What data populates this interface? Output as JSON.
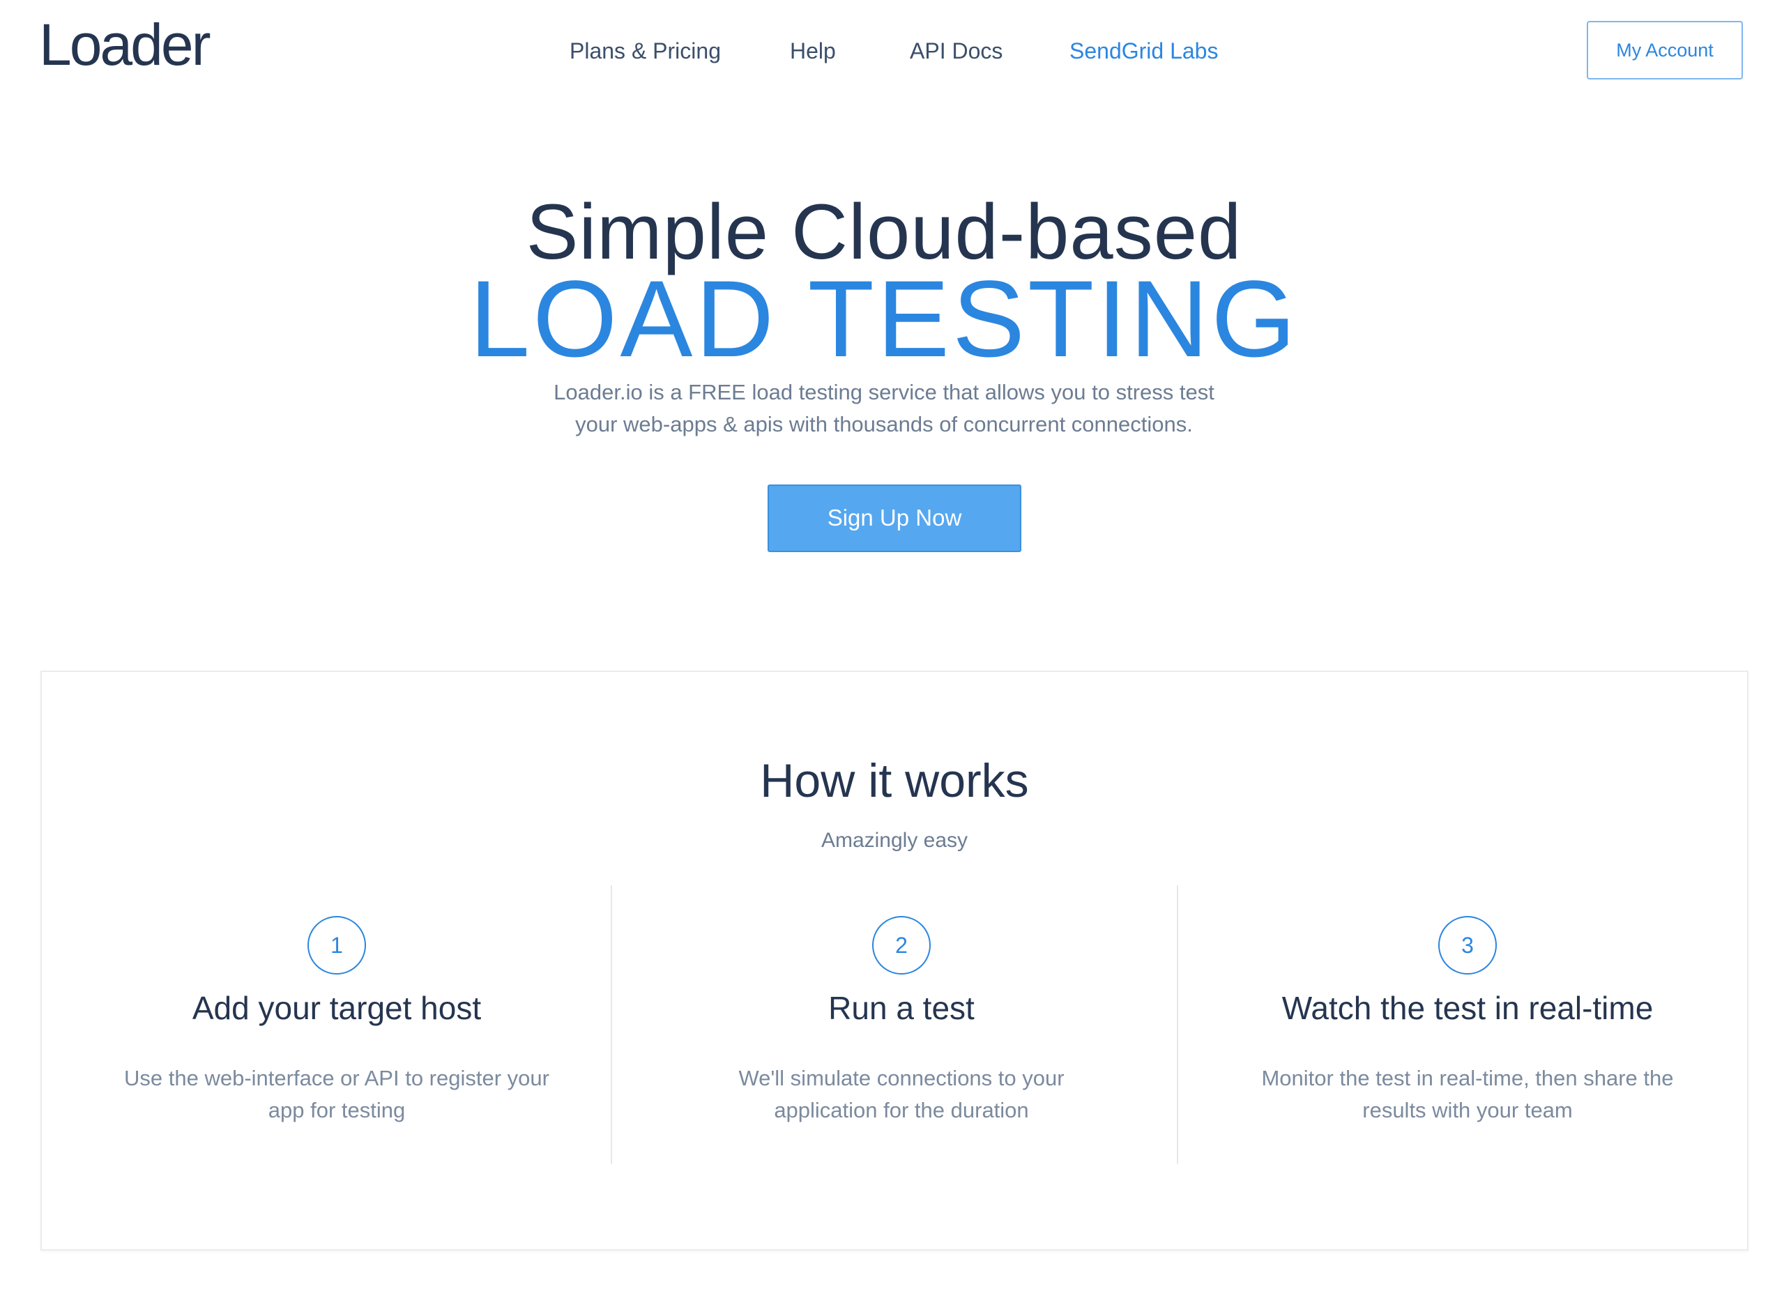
{
  "header": {
    "logo": "Loader",
    "nav": [
      {
        "label": "Plans & Pricing"
      },
      {
        "label": "Help"
      },
      {
        "label": "API Docs"
      },
      {
        "label": "SendGrid Labs"
      }
    ],
    "account_label": "My Account"
  },
  "hero": {
    "line1": "Simple Cloud-based",
    "line2": "LOAD TESTING",
    "description": "Loader.io is a FREE load testing service that allows you to stress test your web-apps & apis with thousands of concurrent connections.",
    "signup_label": "Sign Up Now"
  },
  "how_it_works": {
    "title": "How it works",
    "subtitle": "Amazingly easy",
    "steps": [
      {
        "number": "1",
        "title": "Add your target host",
        "description": "Use the web-interface or API to register your app for testing"
      },
      {
        "number": "2",
        "title": "Run a test",
        "description": "We'll simulate connections to your application for the duration"
      },
      {
        "number": "3",
        "title": "Watch the test in real-time",
        "description": "Monitor the test in real-time, then share the results with your team"
      }
    ]
  },
  "colors": {
    "accent": "#2b86e0",
    "button": "#55a7f0",
    "heading": "#253550",
    "muted": "#6c7c92"
  }
}
